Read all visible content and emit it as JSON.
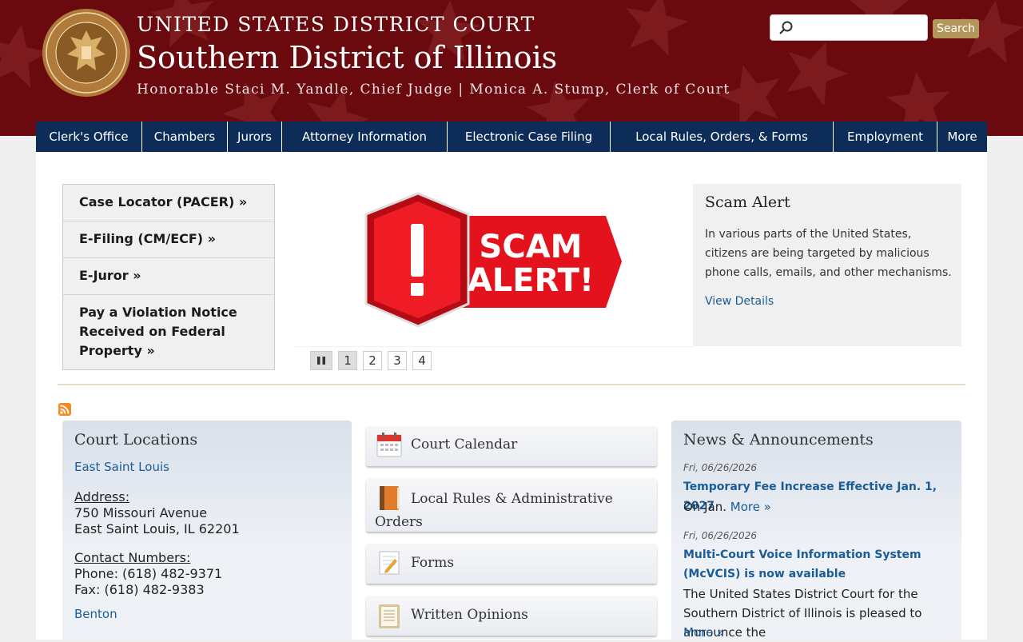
{
  "header": {
    "court_line": "UNITED STATES DISTRICT COURT",
    "district": "Southern District of Illinois",
    "officers": "Honorable Staci M. Yandle, Chief Judge | Monica A. Stump, Clerk of Court",
    "search_button": "Search",
    "search_placeholder": ""
  },
  "nav": [
    {
      "label": "Clerk's Office"
    },
    {
      "label": "Chambers"
    },
    {
      "label": "Jurors"
    },
    {
      "label": "Attorney Information"
    },
    {
      "label": "Electronic Case Filing"
    },
    {
      "label": "Local Rules, Orders, & Forms"
    },
    {
      "label": "Employment"
    },
    {
      "label": "More"
    }
  ],
  "quick_links": [
    {
      "label": "Case Locator (PACER) »"
    },
    {
      "label": "E-Filing (CM/ECF) »"
    },
    {
      "label": "E-Juror »"
    },
    {
      "label": "Pay a Violation Notice Received on Federal Property »"
    }
  ],
  "slider": {
    "image_text_1": "SCAM",
    "image_text_2": "ALERT!",
    "title": "Scam Alert",
    "text": "In various parts of the United States, citizens are being targeted by malicious phone calls, emails, and other mechanisms.",
    "link": "View Details",
    "pages": [
      "1",
      "2",
      "3",
      "4"
    ],
    "active_page": "1"
  },
  "locations": {
    "title": "Court Locations",
    "first_link": "East Saint Louis",
    "address_label": "Address:",
    "address_1": "750 Missouri Avenue",
    "address_2": "East Saint Louis, IL 62201",
    "contact_label": "Contact Numbers:",
    "phone": "Phone: (618) 482-9371",
    "fax": "Fax: (618) 482-9383",
    "second_link": "Benton"
  },
  "tiles": [
    {
      "label": "Court Calendar"
    },
    {
      "label": "Local Rules & Administrative Orders"
    },
    {
      "label": "Forms"
    },
    {
      "label": "Written Opinions"
    }
  ],
  "news": {
    "title": "News & Announcements",
    "items": [
      {
        "date": "Fri, 06/26/2026",
        "headline": "Temporary Fee Increase Effective Jan. 1, 2027",
        "body": "On Jan.",
        "more": "More »"
      },
      {
        "date": "Fri, 06/26/2026",
        "headline": "Multi-Court Voice Information System (McVCIS) is now available",
        "body": "The United States District Court for the Southern District of Illinois is pleased to announce the",
        "more": "More »"
      }
    ]
  },
  "colors": {
    "header_bg": "#6b0a0e",
    "nav_bg": "#0d2d58",
    "link": "#1a5c98",
    "search_btn": "#b39659",
    "gold_divider": "#e6dcc6"
  }
}
